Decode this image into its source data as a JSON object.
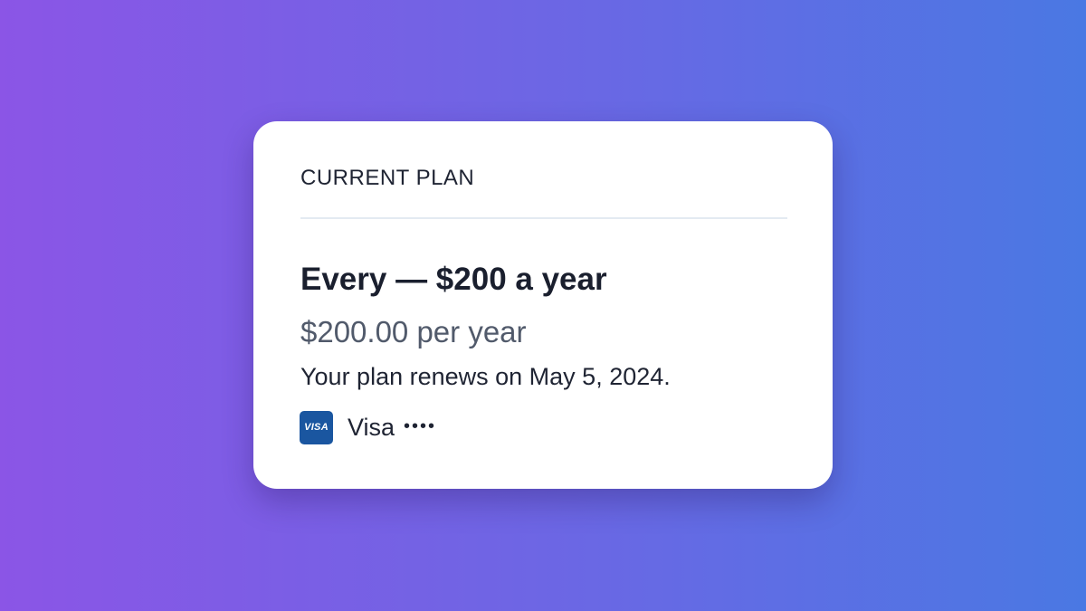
{
  "plan_card": {
    "section_label": "CURRENT PLAN",
    "plan_name": "Every — $200 a year",
    "price": "$200.00 per year",
    "renewal_text": "Your plan renews on May 5, 2024.",
    "payment_method": {
      "icon": "visa-icon",
      "icon_text": "VISA",
      "brand": "Visa",
      "masked_number": "••••"
    }
  },
  "colors": {
    "background_gradient_start": "#8b55e6",
    "background_gradient_end": "#4a78e3",
    "card_background": "#ffffff",
    "visa_blue": "#1a56a0",
    "primary_text": "#1a1f2e",
    "secondary_text": "#515a6b"
  }
}
